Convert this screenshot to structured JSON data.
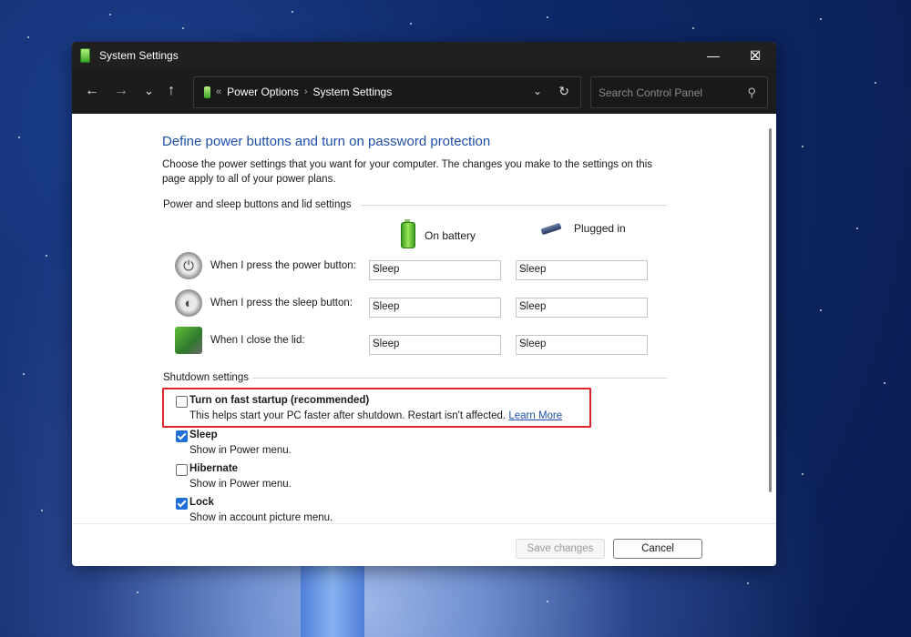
{
  "window": {
    "title": "System Settings",
    "controls": {
      "minimize": "—",
      "maximize": "☐",
      "close": "✕"
    }
  },
  "nav": {
    "back": "←",
    "forward": "→",
    "recent": "⌄",
    "up": "↑",
    "breadcrumb_prefix": "«",
    "breadcrumb": [
      "Power Options",
      "System Settings"
    ],
    "breadcrumb_sep": "›",
    "search_placeholder": "Search Control Panel"
  },
  "content": {
    "heading": "Define power buttons and turn on password protection",
    "description": "Choose the power settings that you want for your computer. The changes you make to the settings on this page apply to all of your power plans.",
    "buttons_section": "Power and sleep buttons and lid settings",
    "columns": {
      "battery": "On battery",
      "plugged": "Plugged in"
    },
    "rows": [
      {
        "label": "When I press the power button:",
        "battery": "Sleep",
        "plugged": "Sleep",
        "icon": "power-icon"
      },
      {
        "label": "When I press the sleep button:",
        "battery": "Sleep",
        "plugged": "Sleep",
        "icon": "sleep-icon"
      },
      {
        "label": "When I close the lid:",
        "battery": "Sleep",
        "plugged": "Sleep",
        "icon": "laptop-lid-icon"
      }
    ],
    "shutdown_section": "Shutdown settings",
    "options": [
      {
        "label": "Turn on fast startup (recommended)",
        "desc": "This helps start your PC faster after shutdown. Restart isn't affected.",
        "link": "Learn More",
        "checked": false
      },
      {
        "label": "Sleep",
        "desc": "Show in Power menu.",
        "checked": true
      },
      {
        "label": "Hibernate",
        "desc": "Show in Power menu.",
        "checked": false
      },
      {
        "label": "Lock",
        "desc": "Show in account picture menu.",
        "checked": true
      }
    ]
  },
  "footer": {
    "save": "Save changes",
    "cancel": "Cancel"
  },
  "colors": {
    "accent": "#1f6fd6",
    "heading": "#1f4ea8",
    "highlight": "#e0242c"
  }
}
